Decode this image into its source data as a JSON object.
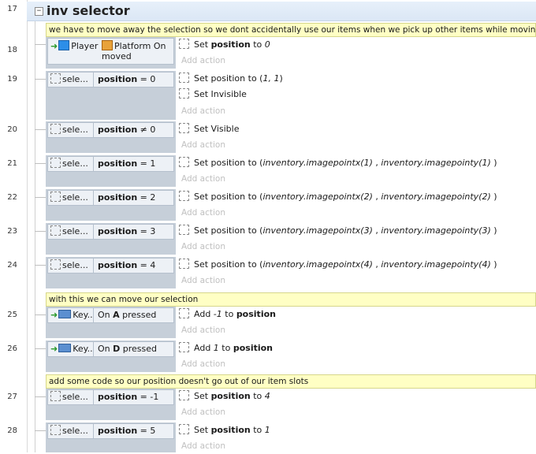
{
  "group": {
    "title": "inv selector",
    "line": "17"
  },
  "comments": [
    "we have to move away the selection so we dont accidentally use our items when we pick up other items while moving",
    "with this we can move our selection",
    "add some code so our position doesn't go out of our item slots"
  ],
  "add_action_label": "Add action",
  "events": [
    {
      "line": "18",
      "obj": "Player",
      "cond_a": "Platform On",
      "cond_b": "moved",
      "act_a": "Set ",
      "act_b": "position",
      "act_c": " to ",
      "act_d": "0"
    },
    {
      "line": "19",
      "obj": "sele...",
      "cond": "position",
      "cond_op": " = 0",
      "act1": "Set position to (",
      "act1_arg": "1, 1",
      "act1_end": ")",
      "act2": "Set Invisible"
    },
    {
      "line": "20",
      "obj": "sele...",
      "cond": "position",
      "cond_op": " ≠ 0",
      "act1": "Set Visible"
    },
    {
      "line": "21",
      "obj": "sele...",
      "cond": "position",
      "cond_op": " = 1",
      "act_pre": "Set position to (",
      "act_x": "inventory.imagepointx(1)",
      "act_sep": " , ",
      "act_y": "inventory.imagepointy(1)",
      "act_end": " )"
    },
    {
      "line": "22",
      "obj": "sele...",
      "cond": "position",
      "cond_op": " = 2",
      "act_pre": "Set position to (",
      "act_x": "inventory.imagepointx(2)",
      "act_sep": " , ",
      "act_y": "inventory.imagepointy(2)",
      "act_end": " )"
    },
    {
      "line": "23",
      "obj": "sele...",
      "cond": "position",
      "cond_op": " = 3",
      "act_pre": "Set position to (",
      "act_x": "inventory.imagepointx(3)",
      "act_sep": " , ",
      "act_y": "inventory.imagepointy(3)",
      "act_end": " )"
    },
    {
      "line": "24",
      "obj": "sele...",
      "cond": "position",
      "cond_op": " = 4",
      "act_pre": "Set position to (",
      "act_x": "inventory.imagepointx(4)",
      "act_sep": " , ",
      "act_y": "inventory.imagepointy(4)",
      "act_end": " )"
    },
    {
      "line": "25",
      "obj": "Key...",
      "cond_pre": "On ",
      "cond_key": "A",
      "cond_post": " pressed",
      "act_a": "Add ",
      "act_num": "-1",
      "act_mid": " to ",
      "act_var": "position"
    },
    {
      "line": "26",
      "obj": "Key...",
      "cond_pre": "On ",
      "cond_key": "D",
      "cond_post": " pressed",
      "act_a": "Add ",
      "act_num": "1",
      "act_mid": " to ",
      "act_var": "position"
    },
    {
      "line": "27",
      "obj": "sele...",
      "cond": "position",
      "cond_op": " = -1",
      "act_a": "Set ",
      "act_var": "position",
      "act_mid": " to ",
      "act_num": "4"
    },
    {
      "line": "28",
      "obj": "sele...",
      "cond": "position",
      "cond_op": " = 5",
      "act_a": "Set ",
      "act_var": "position",
      "act_mid": " to ",
      "act_num": "1"
    }
  ],
  "icons": {
    "keyboard": "keyboard-icon",
    "player": "player-sprite-icon",
    "platform": "platform-behavior-icon",
    "system": "dashed-object-icon",
    "arrow": "trigger-arrow-icon"
  },
  "colors": {
    "comment_bg": "#ffffc4",
    "condition_bg": "#edf1f6",
    "condition_col": "#c6cfd9",
    "group_bg": "#dbe7f5"
  }
}
